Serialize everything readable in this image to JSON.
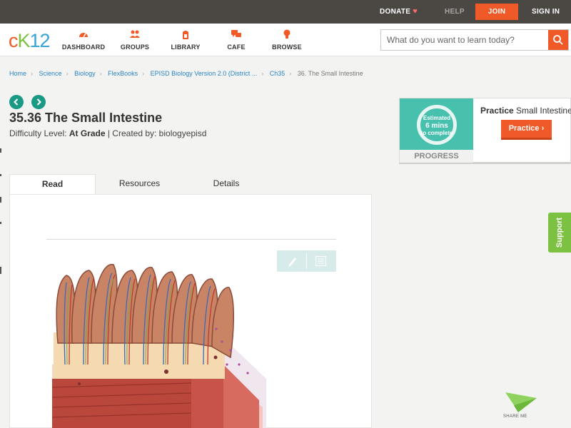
{
  "topbar": {
    "donate": "DONATE",
    "help": "HELP",
    "join": "JOIN",
    "signin": "SIGN IN"
  },
  "nav": {
    "logo": {
      "c": "c",
      "k": "K",
      "t": "12"
    },
    "items": [
      {
        "label": "DASHBOARD",
        "icon": "dashboard-icon"
      },
      {
        "label": "GROUPS",
        "icon": "groups-icon"
      },
      {
        "label": "LIBRARY",
        "icon": "library-icon"
      },
      {
        "label": "CAFE",
        "icon": "cafe-icon"
      },
      {
        "label": "BROWSE",
        "icon": "browse-icon"
      }
    ],
    "search_placeholder": "What do you want to learn today?"
  },
  "breadcrumb": [
    "Home",
    "Science",
    "Biology",
    "FlexBooks",
    "EPISD Biology Version 2.0 (District ...",
    "Ch35",
    "36. The Small Intestine"
  ],
  "page": {
    "title": "35.36 The Small Intestine",
    "difficulty_label": "Difficulty Level:",
    "difficulty_value": "At Grade",
    "created_by": "| Created by: biologyepisd"
  },
  "tabs": [
    "Read",
    "Resources",
    "Details"
  ],
  "practice": {
    "estimate_line1": "Estimated",
    "estimate_line2": "6 mins",
    "estimate_line3": "to complete",
    "progress": "PROGRESS",
    "title_bold": "Practice",
    "title_rest": "Small Intestine",
    "button": "Practice"
  },
  "support": "Support",
  "share": "SHARE ME",
  "colors": {
    "brand_orange": "#f05a28",
    "brand_green": "#7cc142",
    "teal": "#1a9a85",
    "topbar": "#4b4743"
  }
}
